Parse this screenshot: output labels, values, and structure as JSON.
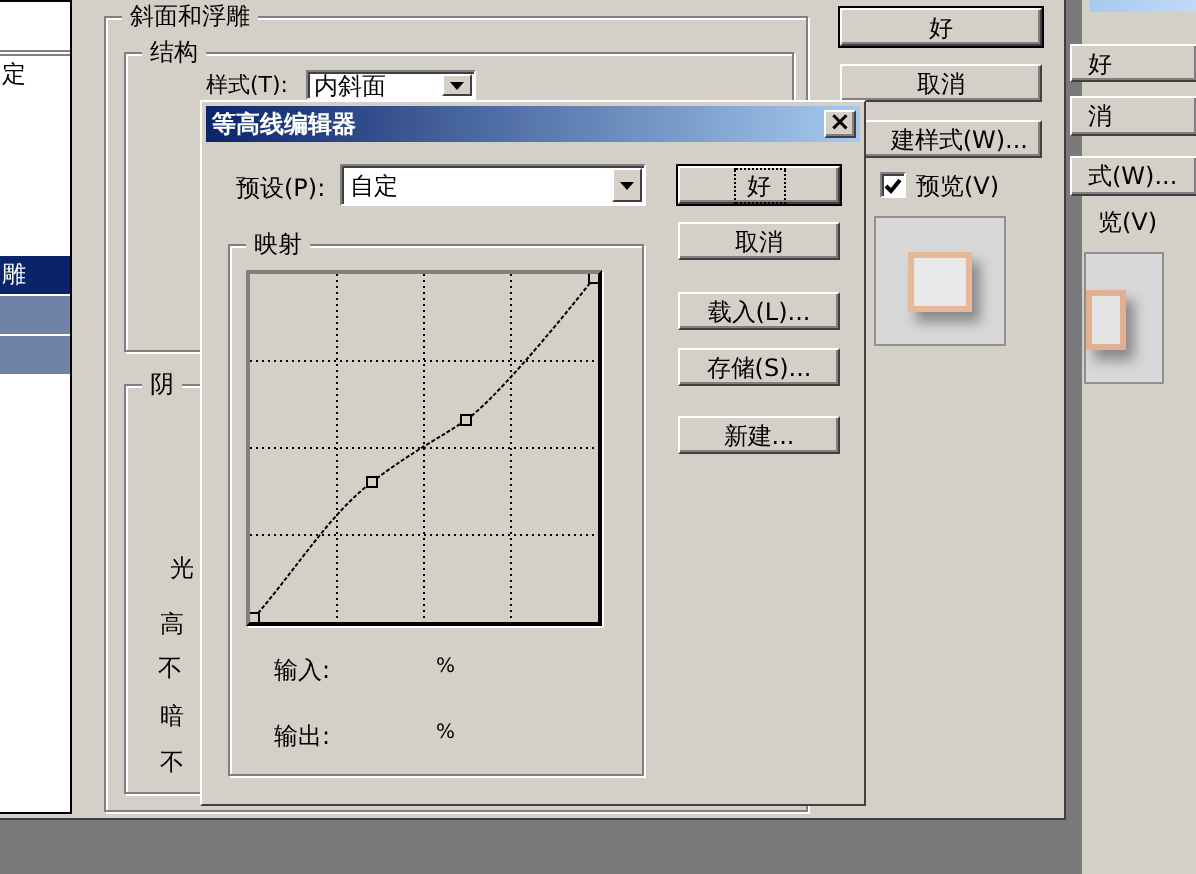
{
  "rear_window": {
    "buttons": [
      "好",
      "消",
      "式(W)..."
    ],
    "preview_label": "览(V)"
  },
  "layer_style": {
    "style_list": [
      {
        "label": "定",
        "selected": false
      },
      {
        "selected": false
      },
      {
        "selected": false
      },
      {
        "selected": false
      },
      {
        "selected": false
      },
      {
        "label": "雕",
        "selected": true
      },
      {
        "highlighted": true,
        "selected": false
      },
      {
        "highlighted": true,
        "selected": false
      },
      {
        "selected": false
      },
      {
        "selected": false
      },
      {
        "selected": false
      },
      {
        "selected": false
      },
      {
        "selected": false
      }
    ],
    "bevel_group": {
      "title": "斜面和浮雕",
      "structure_title": "结构",
      "style_label": "样式(T):",
      "style_value": "内斜面"
    },
    "shading_group": {
      "title": "阴",
      "labels": [
        "光",
        "高",
        "不",
        "暗",
        "不"
      ]
    },
    "buttons": [
      {
        "label": "好",
        "default": true
      },
      {
        "label": "取消",
        "default": false
      },
      {
        "label": "建样式(W)...",
        "default": false
      }
    ],
    "preview": {
      "label": "预览(V)",
      "checked": true
    }
  },
  "contour_editor": {
    "title": "等高线编辑器",
    "close": "×",
    "preset_label": "预设(P):",
    "preset_value": "自定",
    "buttons": [
      {
        "label": "好",
        "focused": true
      },
      {
        "label": "取消",
        "focused": false
      },
      {
        "label": "载入(L)...",
        "focused": false
      },
      {
        "label": "存储(S)...",
        "focused": false
      },
      {
        "label": "新建...",
        "focused": false
      }
    ],
    "mapping_title": "映射",
    "input_label": "输入:",
    "input_unit": "%",
    "output_label": "输出:",
    "output_unit": "%"
  }
}
